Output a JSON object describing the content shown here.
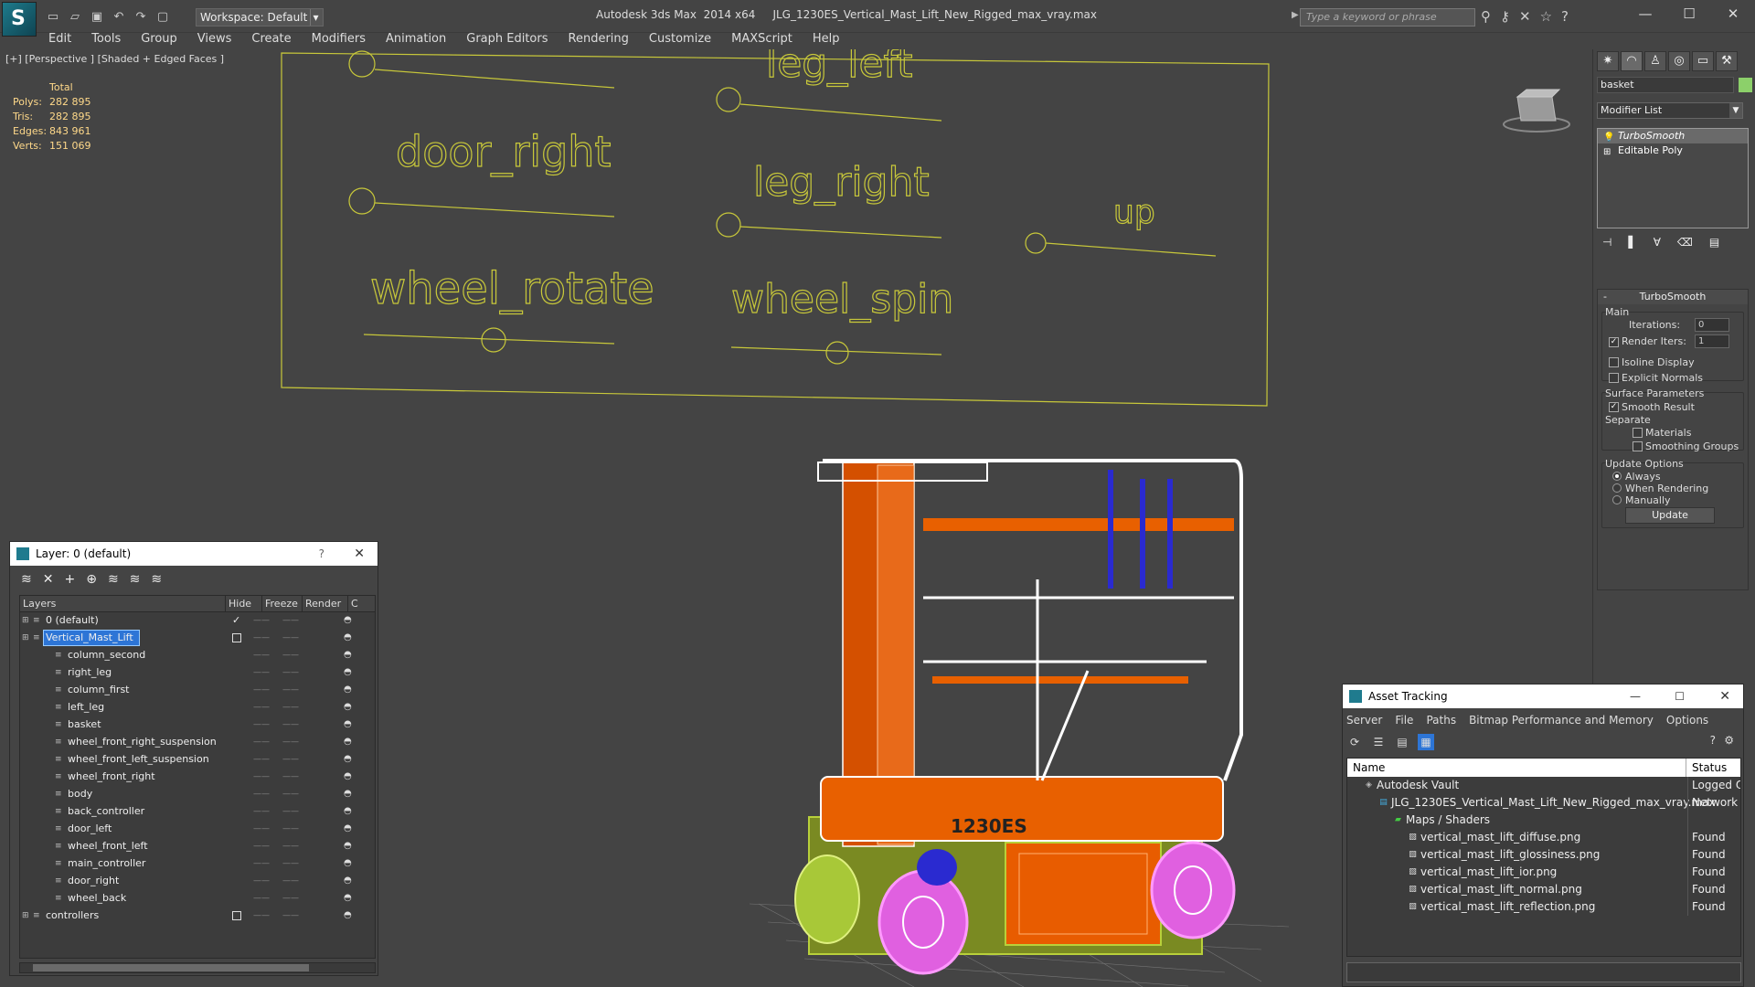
{
  "app": {
    "title": "Autodesk 3ds Max  2014 x64",
    "file": "JLG_1230ES_Vertical_Mast_Lift_New_Rigged_max_vray.max",
    "workspace": "Workspace: Default",
    "search_placeholder": "Type a keyword or phrase"
  },
  "menu": [
    "Edit",
    "Tools",
    "Group",
    "Views",
    "Create",
    "Modifiers",
    "Animation",
    "Graph Editors",
    "Rendering",
    "Customize",
    "MAXScript",
    "Help"
  ],
  "viewport": {
    "label": "[+] [Perspective ] [Shaded + Edged Faces ]",
    "stats": {
      "total_label": "Total",
      "rows": [
        {
          "key": "Polys:",
          "value": "282 895"
        },
        {
          "key": "Tris:",
          "value": "282 895"
        },
        {
          "key": "Edges:",
          "value": "843 961"
        },
        {
          "key": "Verts:",
          "value": "151 069"
        }
      ]
    },
    "controls": [
      "leg_left",
      "door_right",
      "leg_right",
      "up",
      "wheel_rotate",
      "wheel_spin"
    ],
    "vehicle_label": "1230ES"
  },
  "command_panel": {
    "object_name": "basket",
    "object_color": "#8cd06a",
    "modifier_list": "Modifier List",
    "stack": [
      "TurboSmooth",
      "Editable Poly"
    ],
    "rollout": {
      "title": "TurboSmooth",
      "main": "Main",
      "iterations_label": "Iterations:",
      "iterations": "0",
      "render_iters_label": "Render Iters:",
      "render_iters": "1",
      "isoline": "Isoline Display",
      "explicit": "Explicit Normals",
      "surface": "Surface Parameters",
      "smooth": "Smooth Result",
      "separate": "Separate",
      "materials": "Materials",
      "smoothing": "Smoothing Groups",
      "update_options": "Update Options",
      "always": "Always",
      "when_rendering": "When Rendering",
      "manually": "Manually",
      "update": "Update"
    }
  },
  "layer_dialog": {
    "title": "Layer: 0 (default)",
    "columns": [
      "Layers",
      "Hide",
      "Freeze",
      "Render",
      "C"
    ],
    "rows": [
      {
        "name": "0 (default)",
        "level": 0,
        "checked": true
      },
      {
        "name": "Vertical_Mast_Lift",
        "level": 0,
        "selected": true,
        "box": true
      },
      {
        "name": "column_second",
        "level": 1
      },
      {
        "name": "right_leg",
        "level": 1
      },
      {
        "name": "column_first",
        "level": 1
      },
      {
        "name": "left_leg",
        "level": 1
      },
      {
        "name": "basket",
        "level": 1
      },
      {
        "name": "wheel_front_right_suspension",
        "level": 1
      },
      {
        "name": "wheel_front_left_suspension",
        "level": 1
      },
      {
        "name": "wheel_front_right",
        "level": 1
      },
      {
        "name": "body",
        "level": 1
      },
      {
        "name": "back_controller",
        "level": 1
      },
      {
        "name": "door_left",
        "level": 1
      },
      {
        "name": "wheel_front_left",
        "level": 1
      },
      {
        "name": "main_controller",
        "level": 1
      },
      {
        "name": "door_right",
        "level": 1
      },
      {
        "name": "wheel_back",
        "level": 1
      },
      {
        "name": "controllers",
        "level": 0,
        "box": true
      }
    ]
  },
  "asset_tracking": {
    "title": "Asset Tracking",
    "menu": [
      "Server",
      "File",
      "Paths",
      "Bitmap Performance and Memory",
      "Options"
    ],
    "columns": [
      "Name",
      "Status"
    ],
    "rows": [
      {
        "name": "Autodesk Vault",
        "status": "Logged Out",
        "level": 0
      },
      {
        "name": "JLG_1230ES_Vertical_Mast_Lift_New_Rigged_max_vray.max",
        "status": "Network Pat",
        "level": 1
      },
      {
        "name": "Maps / Shaders",
        "status": "",
        "level": 2
      },
      {
        "name": "vertical_mast_lift_diffuse.png",
        "status": "Found",
        "level": 3
      },
      {
        "name": "vertical_mast_lift_glossiness.png",
        "status": "Found",
        "level": 3
      },
      {
        "name": "vertical_mast_lift_ior.png",
        "status": "Found",
        "level": 3
      },
      {
        "name": "vertical_mast_lift_normal.png",
        "status": "Found",
        "level": 3
      },
      {
        "name": "vertical_mast_lift_reflection.png",
        "status": "Found",
        "level": 3
      }
    ]
  }
}
